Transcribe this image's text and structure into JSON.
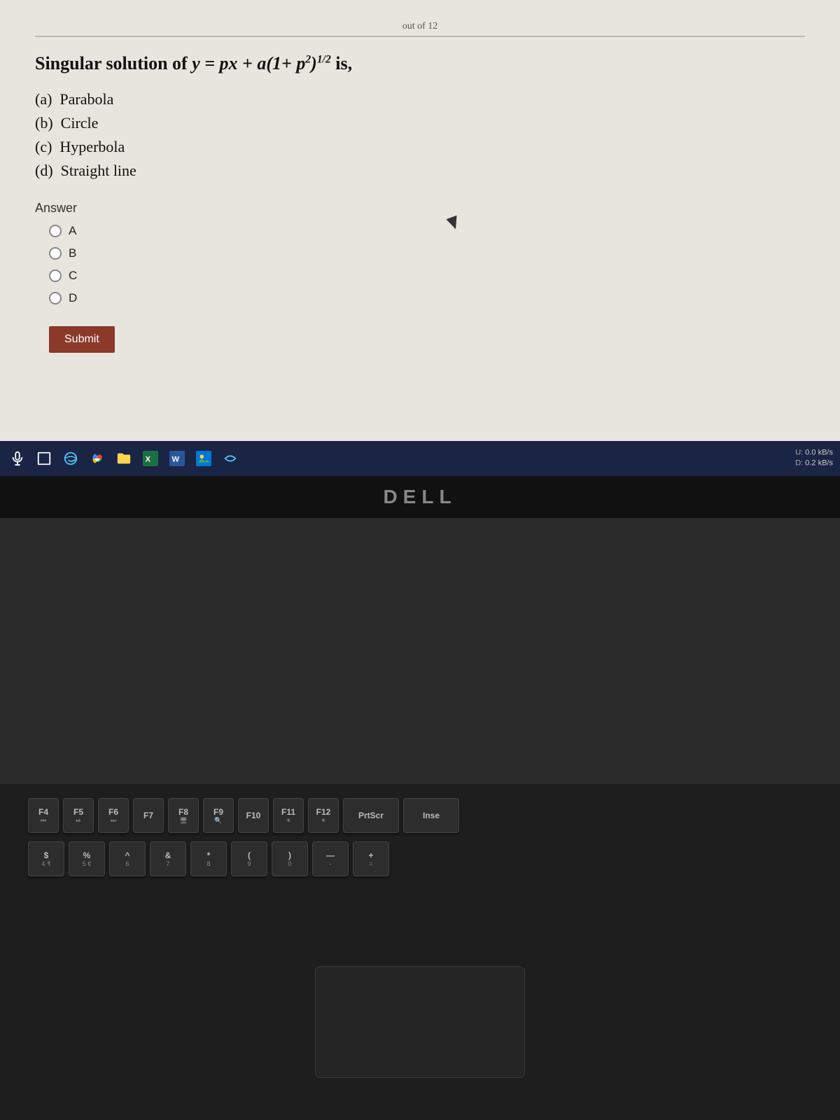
{
  "screen": {
    "progress": "out of 12",
    "question": {
      "prefix": "Singular solution of ",
      "formula": "y = px + a(1 + p²)^(1/2)",
      "suffix": " is,",
      "options": [
        {
          "label": "(a)",
          "text": "Parabola"
        },
        {
          "label": "(b)",
          "text": "Circle"
        },
        {
          "label": "(c)",
          "text": "Hyperbola"
        },
        {
          "label": "(d)",
          "text": "Straight line"
        }
      ]
    },
    "answer": {
      "label": "Answer",
      "choices": [
        "A",
        "B",
        "C",
        "D"
      ]
    },
    "submit_button": "Submit"
  },
  "taskbar": {
    "network_upload_label": "U:",
    "network_upload_value": "0.0 kB/s",
    "network_download_label": "D:",
    "network_download_value": "0.2 kB/s"
  },
  "bezel": {
    "brand": "DELL"
  },
  "keyboard": {
    "fn_keys": [
      {
        "main": "F4",
        "sub": "⏮"
      },
      {
        "main": "F5",
        "sub": "⏯"
      },
      {
        "main": "F6",
        "sub": "⏭"
      },
      {
        "main": "F7",
        "sub": ""
      },
      {
        "main": "F8",
        "sub": "🖥"
      },
      {
        "main": "F9",
        "sub": "🔍"
      },
      {
        "main": "F10",
        "sub": ""
      },
      {
        "main": "F11",
        "sub": "☀"
      },
      {
        "main": "F12",
        "sub": "☀"
      },
      {
        "main": "PrtScr",
        "sub": ""
      },
      {
        "main": "Inse",
        "sub": ""
      }
    ],
    "number_row": [
      {
        "main": "$",
        "sub": "4 ₹"
      },
      {
        "main": "%",
        "sub": "5 €"
      },
      {
        "main": "^",
        "sub": "6"
      },
      {
        "main": "&",
        "sub": "7"
      },
      {
        "main": "*",
        "sub": "8"
      },
      {
        "main": "(",
        "sub": "9"
      },
      {
        "main": ")",
        "sub": "0"
      },
      {
        "main": "—",
        "sub": "-"
      },
      {
        "main": "+",
        "sub": "="
      }
    ]
  }
}
